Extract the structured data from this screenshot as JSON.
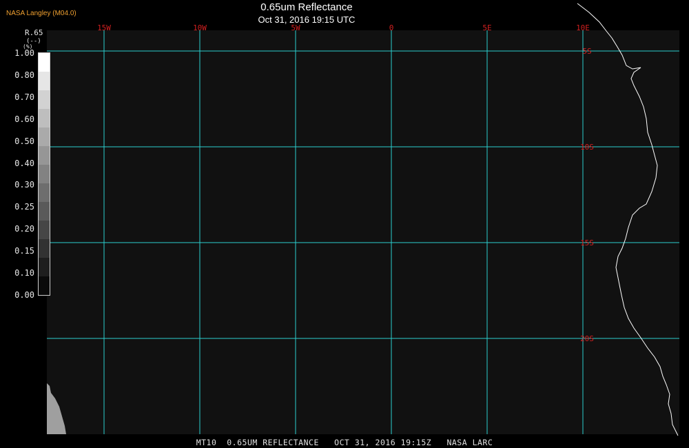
{
  "agency": "NASA Langley (M04.0)",
  "title": "0.65um Reflectance",
  "timestamp": "Oct 31, 2016 19:15 UTC",
  "legend": {
    "variable": "R.65",
    "units": "(--)",
    "unit_symbol": "(%)",
    "ticks": [
      "1.00",
      "0.80",
      "0.70",
      "0.60",
      "0.50",
      "0.40",
      "0.30",
      "0.25",
      "0.20",
      "0.15",
      "0.10",
      "0.00"
    ],
    "colors": [
      "#ffffff",
      "#e6e6e6",
      "#d2d2d2",
      "#bebebe",
      "#aaaaaa",
      "#969696",
      "#828282",
      "#6e6e6e",
      "#5a5a5a",
      "#464646",
      "#323232",
      "#1e1e1e",
      "#0a0a0a"
    ]
  },
  "map": {
    "background_color": "#111111",
    "grid_color": "#2ad0d0",
    "label_color": "#d22020",
    "coast_color": "#ffffff",
    "longitudes": [
      {
        "label": "15W",
        "lon": -15
      },
      {
        "label": "10W",
        "lon": -10
      },
      {
        "label": "5W",
        "lon": -5
      },
      {
        "label": "0",
        "lon": 0
      },
      {
        "label": "5E",
        "lon": 5
      },
      {
        "label": "10E",
        "lon": 10
      }
    ],
    "latitudes": [
      {
        "label": "5S",
        "lat": -5
      },
      {
        "label": "10S",
        "lat": -10
      },
      {
        "label": "15S",
        "lat": -15
      },
      {
        "label": "20S",
        "lat": -20
      }
    ]
  },
  "caption": "MT10  0.65UM REFLECTANCE   OCT 31, 2016 19:15Z   NASA LARC"
}
